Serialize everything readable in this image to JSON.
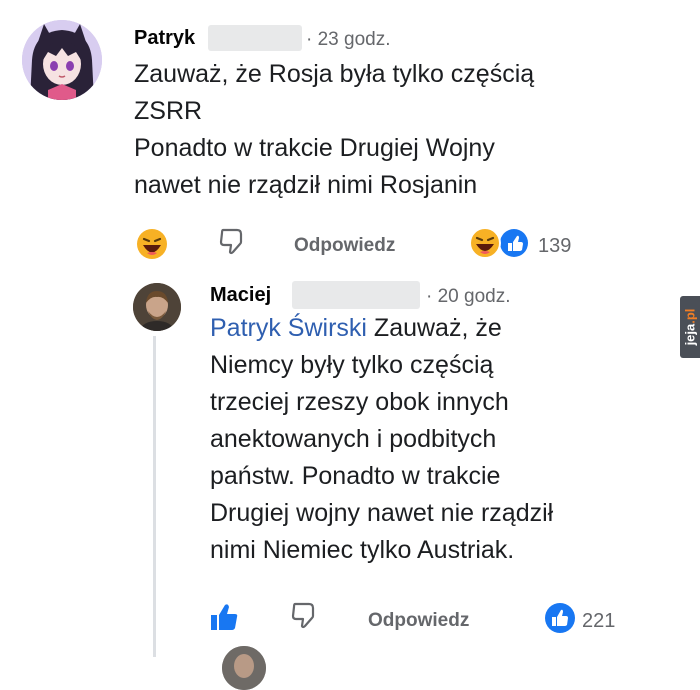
{
  "comment1": {
    "author": "Patryk",
    "time": "· 23 godz.",
    "lines": [
      "Zauważ, że Rosja była tylko częścią",
      "ZSRR",
      "Ponadto w trakcie Drugiej Wojny",
      "nawet nie rządził nimi Rosjanin"
    ],
    "reply_label": "Odpowiedz",
    "reaction_count": "139"
  },
  "reply1": {
    "author": "Maciej",
    "time": "· 20 godz.",
    "mention": "Patryk Świrski",
    "lines": [
      "Zauważ, że",
      "Niemcy były tylko częścią",
      "trzeciej rzeszy obok innych",
      "anektowanych i podbitych",
      "państw. Ponadto w trakcie",
      "Drugiej wojny nawet nie rządził",
      "nimi Niemiec tylko Austriak."
    ],
    "reply_label": "Odpowiedz",
    "reaction_count": "221"
  },
  "watermark": {
    "brand": "jeja",
    "tld": ".pl"
  },
  "colors": {
    "like_blue": "#1877f2",
    "haha_yellow": "#f7b125",
    "mention": "#2f5fb0"
  }
}
